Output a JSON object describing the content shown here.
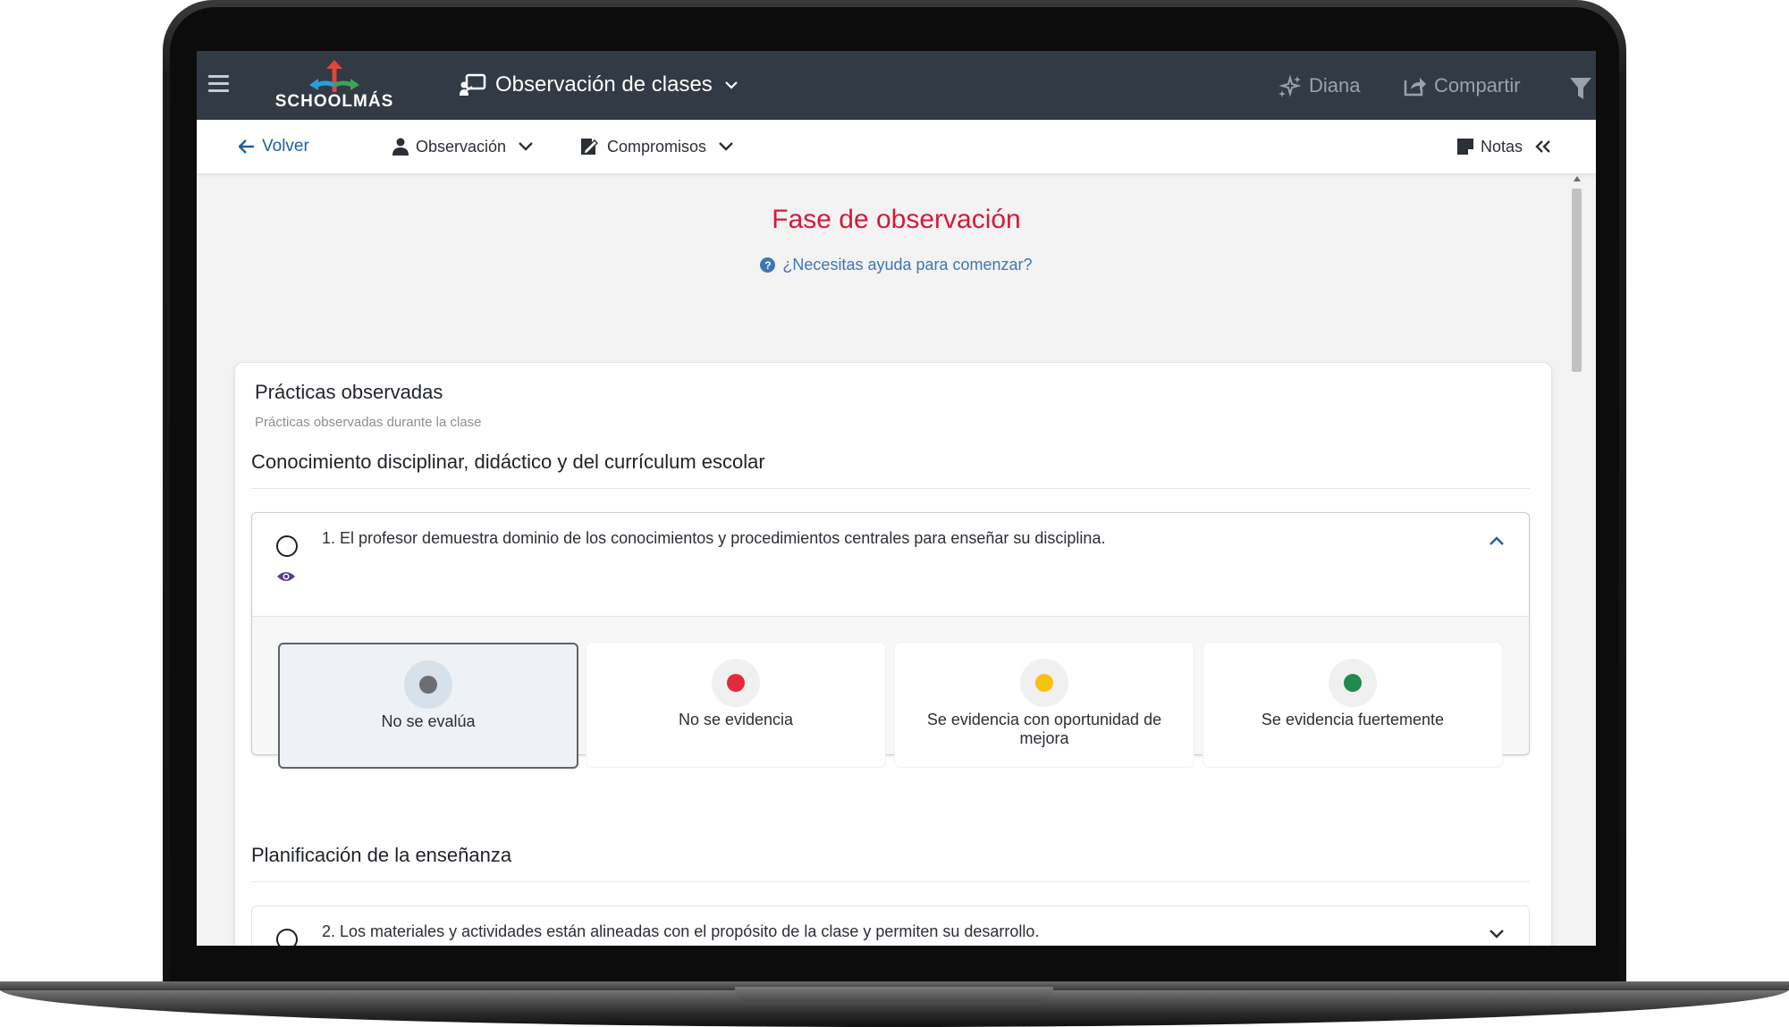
{
  "app": {
    "logo_text": "SCHOOLMÁS",
    "module": "Observación de clases",
    "actions": {
      "diana": "Diana",
      "compartir": "Compartir"
    }
  },
  "subnav": {
    "back": "Volver",
    "observacion": "Observación",
    "compromisos": "Compromisos",
    "notas": "Notas"
  },
  "page": {
    "title": "Fase de observación",
    "help": "¿Necesitas ayuda para comenzar?"
  },
  "card": {
    "title": "Prácticas observadas",
    "subtitle": "Prácticas observadas durante la clase",
    "sections": [
      {
        "heading": "Conocimiento disciplinar, didáctico y del currículum escolar",
        "indicator": "1. El profesor demuestra dominio de los conocimientos y procedimientos centrales para enseñar su disciplina.",
        "expanded": true,
        "options": [
          {
            "label": "No se evalúa",
            "color": "#6b6e73",
            "selected": true
          },
          {
            "label": "No se evidencia",
            "color": "#e22a3b",
            "selected": false
          },
          {
            "label": "Se evidencia con oportunidad de mejora",
            "color": "#f5c211",
            "selected": false
          },
          {
            "label": "Se evidencia fuertemente",
            "color": "#1f8a4c",
            "selected": false
          }
        ]
      },
      {
        "heading": "Planificación de la enseñanza",
        "indicator": "2. Los materiales y actividades están alineadas con el propósito de la clase y permiten su desarrollo.",
        "expanded": false
      }
    ]
  },
  "colors": {
    "topbar": "#323a45",
    "title_red": "#d7193a",
    "link_blue": "#3f77b5",
    "eye_purple": "#5b3b8c"
  },
  "icons": [
    "hamburger-icon",
    "presentation-icon",
    "chevron-down-icon",
    "sparkle-icon",
    "share-icon",
    "filter-icon",
    "arrow-left-icon",
    "user-icon",
    "edit-document-icon",
    "note-icon",
    "double-chevron-left-icon",
    "help-icon",
    "eye-icon",
    "chevron-up-icon"
  ]
}
